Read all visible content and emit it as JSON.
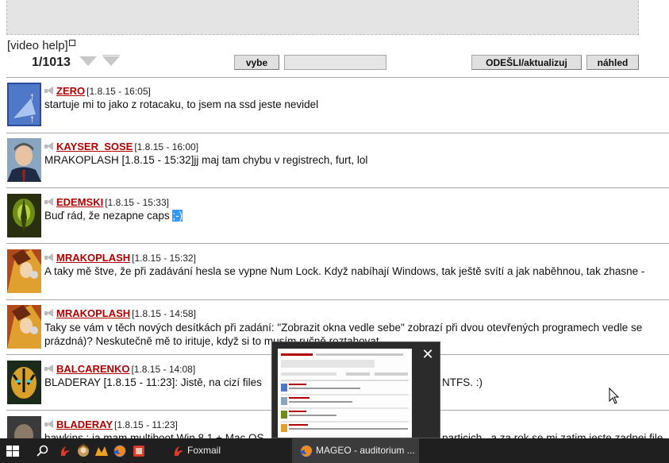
{
  "compose": {
    "video_help": "[video help]",
    "page_counter": "1/1013",
    "select_label": "vybe",
    "send_label": "ODEŠLI/aktualizuj",
    "preview_label": "náhled"
  },
  "posts": [
    {
      "nick": "ZERO",
      "time": "[1.8.15 - 16:05]",
      "text": "startuje mi to jako z rotacaku, to jsem na ssd jeste nevidel"
    },
    {
      "nick": "KAYSER_SOSE",
      "time": "[1.8.15 - 16:00]",
      "text": "MRAKOPLASH [1.8.15 - 15:32]jj maj tam chybu v registrech, furt, lol"
    },
    {
      "nick": "EDEMSKI",
      "time": "[1.8.15 - 15:33]",
      "text": "Buď rád, že nezapne caps ",
      "selected": ";-)"
    },
    {
      "nick": "MRAKOPLASH",
      "time": "[1.8.15 - 15:32]",
      "text": "A taky mě štve, že při zadávání hesla se vypne Num Lock. Když nabíhají Windows, tak ještě svítí a jak naběhnou, tak zhasne -"
    },
    {
      "nick": "MRAKOPLASH",
      "time": "[1.8.15 - 14:58]",
      "text": "Taky se vám v těch nových desítkách při zadání: \"Zobrazit okna vedle sebe\" zobrazí při dvou otevřených programech vedle se",
      "text2": "prázdná)? Neskutečně mě to irituje, když si to musím ručně roztahovat."
    },
    {
      "nick": "BALCARENKO",
      "time": "[1.8.15 - 14:08]",
      "text": "BLADERAY [1.8.15 - 11:23]: Jistě, na cizí files",
      "text_tail": "NTFS. :)"
    },
    {
      "nick": "BLADERAY",
      "time": "[1.8.15 - 11:23]",
      "text": "hawkins : ja mam multiboot Win 8.1 + Mac OS",
      "text_tail": "particich , a za rok se mi zatim jeste zadnej file"
    }
  ],
  "taskbar": {
    "apps": [
      {
        "label": "Foxmail",
        "icon": "foxmail-icon"
      },
      {
        "label": "MAGEO - auditorium ...",
        "icon": "firefox-icon"
      }
    ]
  },
  "colors": {
    "nick": "#b00000",
    "taskbar": "#1f1f1f",
    "selection": "#3399ff"
  }
}
